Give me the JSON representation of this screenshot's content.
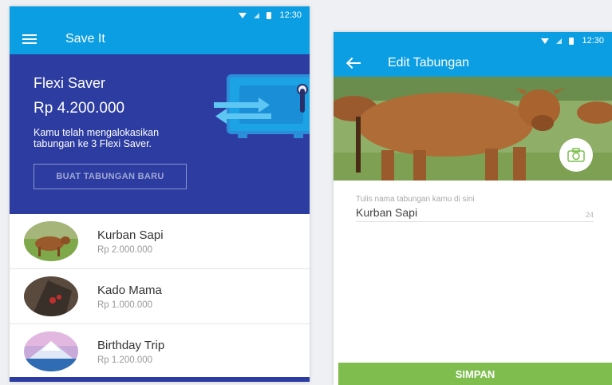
{
  "colors": {
    "primary": "#0b9ee3",
    "hero_bg": "#2c3ca0",
    "accent_green": "#7fbd4f"
  },
  "left_screen": {
    "status_time": "12:30",
    "appbar": {
      "title": "Save It",
      "menu_icon": "hamburger-menu-icon"
    },
    "hero": {
      "title": "Flexi Saver",
      "amount": "Rp 4.200.000",
      "description": "Kamu telah mengalokasikan tabungan ke 3 Flexi Saver.",
      "button_label": "BUAT TABUNGAN BARU",
      "illustration": "safe-icon"
    },
    "savings": [
      {
        "name": "Kurban Sapi",
        "amount": "Rp 2.000.000",
        "thumb": "cow"
      },
      {
        "name": "Kado Mama",
        "amount": "Rp 1.000.000",
        "thumb": "gift"
      },
      {
        "name": "Birthday Trip",
        "amount": "Rp 1.200.000",
        "thumb": "mountain"
      }
    ]
  },
  "right_screen": {
    "status_time": "12:30",
    "appbar": {
      "title": "Edit Tabungan",
      "back_icon": "back-arrow-icon"
    },
    "cover": {
      "camera_icon": "camera-icon"
    },
    "form": {
      "name_label": "Tulis nama tabungan kamu di sini",
      "name_value": "Kurban Sapi",
      "char_counter": "24"
    },
    "submit_label": "SIMPAN"
  }
}
